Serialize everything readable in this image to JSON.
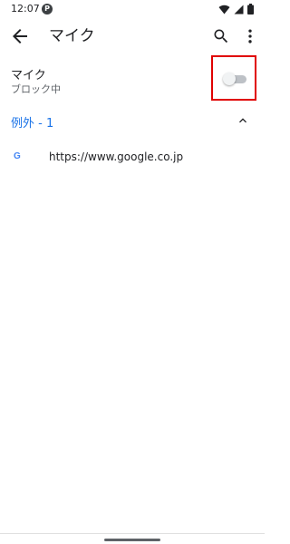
{
  "status_bar": {
    "time": "12:07",
    "notification_icon": "p-notification-icon",
    "right_icons": [
      "wifi-icon",
      "cell-signal-icon",
      "battery-icon"
    ]
  },
  "app_bar": {
    "title": "マイク",
    "back_icon": "arrow-back-icon",
    "search_icon": "search-icon",
    "more_icon": "more-vert-icon"
  },
  "mic_setting": {
    "title": "マイク",
    "subtitle": "ブロック中",
    "toggle_on": false,
    "highlight_color": "#e00000"
  },
  "exceptions": {
    "label": "例外 - 1",
    "expanded": true,
    "sites": [
      {
        "icon": "google-g-icon",
        "url": "https://www.google.co.jp"
      }
    ]
  },
  "colors": {
    "accent": "#1a73e8",
    "text_primary": "#202124",
    "text_secondary": "#5f6368"
  }
}
